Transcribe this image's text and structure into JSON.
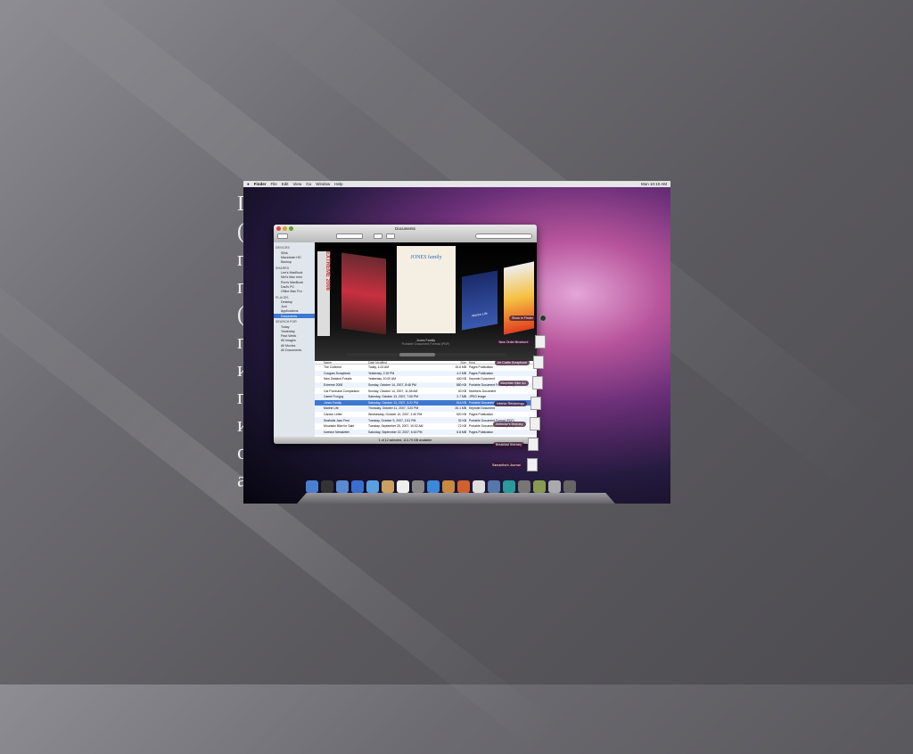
{
  "slide": {
    "text_lines": [
      "Г",
      "(",
      "п",
      "п",
      "(",
      "п",
      "и",
      "п",
      "и",
      "о",
      "а"
    ]
  },
  "menubar": {
    "apple": "",
    "items": [
      "Finder",
      "File",
      "Edit",
      "View",
      "Go",
      "Window",
      "Help"
    ],
    "clock": "Mon 10:10 AM"
  },
  "window": {
    "title": "Documents",
    "search_placeholder": "",
    "sidebar": [
      {
        "heading": "DEVICES",
        "items": [
          "iDisk",
          "Macintosh HD",
          "Backup"
        ]
      },
      {
        "heading": "SHARED",
        "items": [
          "Lee's MacBook",
          "Mel's Mac mini",
          "Ron's MacBook",
          "Dad's PC",
          "Office Mac Pro"
        ]
      },
      {
        "heading": "PLACES",
        "items": [
          "Desktop",
          "Joni",
          "Applications",
          "Documents"
        ]
      },
      {
        "heading": "SEARCH FOR",
        "items": [
          "Today",
          "Yesterday",
          "Past Week",
          "All Images",
          "All Movies",
          "All Documents"
        ]
      }
    ],
    "selected_sidebar": "Documents",
    "coverflow": {
      "left_title": "EXTREME 2008",
      "center_title": "JONES family",
      "caption": "Jones Family",
      "caption_sub": "Portable Document Format (PDF)",
      "right_title": "Marine Life"
    },
    "columns": [
      "Name",
      "Date Modified",
      "Size",
      "Kind"
    ],
    "files": [
      [
        "The Collector",
        "Today, 4:23 AM",
        "15.6 MB",
        "Pages Publication"
      ],
      [
        "Cougars Scrapbook",
        "Yesterday, 2:15 PM",
        "4.2 MB",
        "Pages Publication"
      ],
      [
        "New Zealand Fossils",
        "Yesterday, 10:00 AM",
        "440 KB",
        "Keynote Document"
      ],
      [
        "Extreme 2008",
        "Sunday, October 14, 2007, 8:48 PM",
        "880 KB",
        "Portable Document Format (PDF)"
      ],
      [
        "Car Purchase Comparison",
        "Sunday, October 14, 2007, 11:38 AM",
        "40 KB",
        "Numbers Document"
      ],
      [
        "Camel Fun.jpg",
        "Saturday, October 13, 2007, 7:06 PM",
        "2.7 MB",
        "JPEG image"
      ],
      [
        "Jones Family",
        "Saturday, October 13, 2007, 3:22 PM",
        "516 KB",
        "Portable Document Format (PDF)"
      ],
      [
        "Marine Life",
        "Thursday, October 11, 2007, 3:20 PM",
        "26.1 MB",
        "Keynote Document"
      ],
      [
        "Cardon Letter",
        "Wednesday, October 10, 2007, 2:40 PM",
        "520 KB",
        "Pages Publication"
      ],
      [
        "Seafolds Jazz Fest",
        "Tuesday, October 9, 2007, 2:41 PM",
        "32 KB",
        "Portable Document Format (PDF)"
      ],
      [
        "Mountain Bike for Sale",
        "Tuesday, September 25, 2007, 10:02 AM",
        "72 KB",
        "Portable Document Format (PDF)"
      ],
      [
        "Investor Newsletter",
        "Saturday, September 22, 2007, 6:18 PM",
        "6.8 MB",
        "Pages Publication"
      ]
    ],
    "selected_row": 6,
    "status": "1 of 12 selected, 113.79 GB available"
  },
  "stack": [
    "Show in Finder",
    "New Order Brochure",
    "Art Crafts Scrapbook",
    "Mountain Bike Ad",
    "Interior Renderings",
    "Ambrose's Itinerary",
    "Breakfast Itinerary",
    "Samantha's Journal"
  ],
  "dock_colors": [
    "#4a7fd0",
    "#333",
    "#5a8ad0",
    "#3a6fd0",
    "#58a0e0",
    "#c9a060",
    "#eee",
    "#888",
    "#3b8ad8",
    "#c88a40",
    "#d06030",
    "#ddd",
    "#5577aa",
    "#2a9a9a",
    "#777",
    "#8a9a50",
    "#aaa",
    "#666"
  ]
}
